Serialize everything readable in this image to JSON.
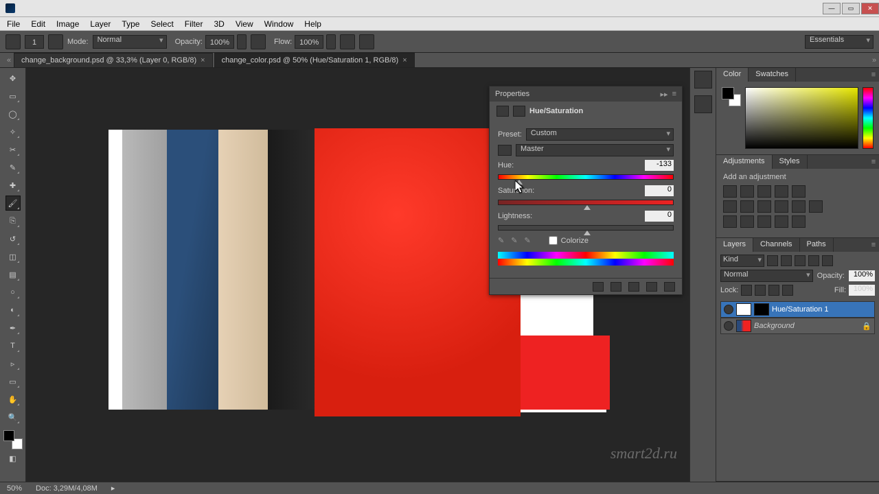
{
  "menu": {
    "file": "File",
    "edit": "Edit",
    "image": "Image",
    "layer": "Layer",
    "type": "Type",
    "select": "Select",
    "filter": "Filter",
    "threeD": "3D",
    "view": "View",
    "window": "Window",
    "help": "Help"
  },
  "options": {
    "brush_size": "1",
    "mode_label": "Mode:",
    "mode_value": "Normal",
    "opacity_label": "Opacity:",
    "opacity_value": "100%",
    "flow_label": "Flow:",
    "flow_value": "100%",
    "workspace": "Essentials"
  },
  "tabs": {
    "tab1": "change_background.psd @ 33,3% (Layer 0, RGB/8)",
    "tab2": "change_color.psd @ 50% (Hue/Saturation 1, RGB/8)"
  },
  "properties": {
    "panel_title": "Properties",
    "adj_title": "Hue/Saturation",
    "preset_label": "Preset:",
    "preset_value": "Custom",
    "channel_value": "Master",
    "hue_label": "Hue:",
    "hue_value": "-133",
    "sat_label": "Saturation:",
    "sat_value": "0",
    "light_label": "Lightness:",
    "light_value": "0",
    "colorize_label": "Colorize"
  },
  "right": {
    "color_tab": "Color",
    "swatches_tab": "Swatches",
    "adjustments_tab": "Adjustments",
    "styles_tab": "Styles",
    "add_adjustment": "Add an adjustment",
    "layers_tab": "Layers",
    "channels_tab": "Channels",
    "paths_tab": "Paths",
    "kind": "Kind",
    "blend": "Normal",
    "opacity_label": "Opacity:",
    "opacity_value": "100%",
    "lock_label": "Lock:",
    "fill_label": "Fill:",
    "fill_value": "100%",
    "layer1": "Hue/Saturation 1",
    "layer2": "Background"
  },
  "status": {
    "zoom": "50%",
    "doc": "Doc: 3,29M/4,08M"
  },
  "watermark": "smart2d.ru"
}
